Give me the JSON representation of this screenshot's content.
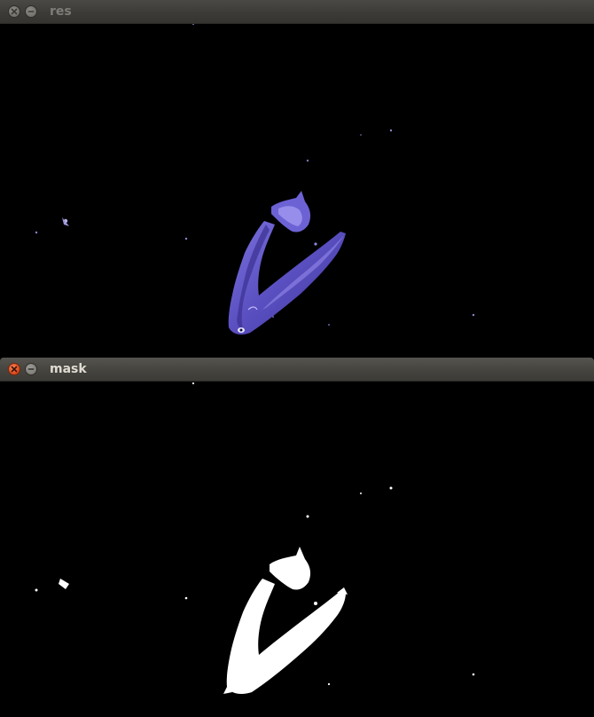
{
  "windows": [
    {
      "title": "res",
      "state": "inactive",
      "content": "filtered-result-image",
      "colors": {
        "fish_fill": "#5a4fc0",
        "fish_highlight": "#8c82e6",
        "fish_shadow": "#3a3190",
        "background": "#000000"
      }
    },
    {
      "title": "mask",
      "state": "active",
      "content": "binary-mask-image",
      "colors": {
        "mask_fill": "#ffffff",
        "background": "#000000"
      }
    }
  ],
  "icons": {
    "close": "close-icon",
    "minimize": "minimize-icon"
  }
}
